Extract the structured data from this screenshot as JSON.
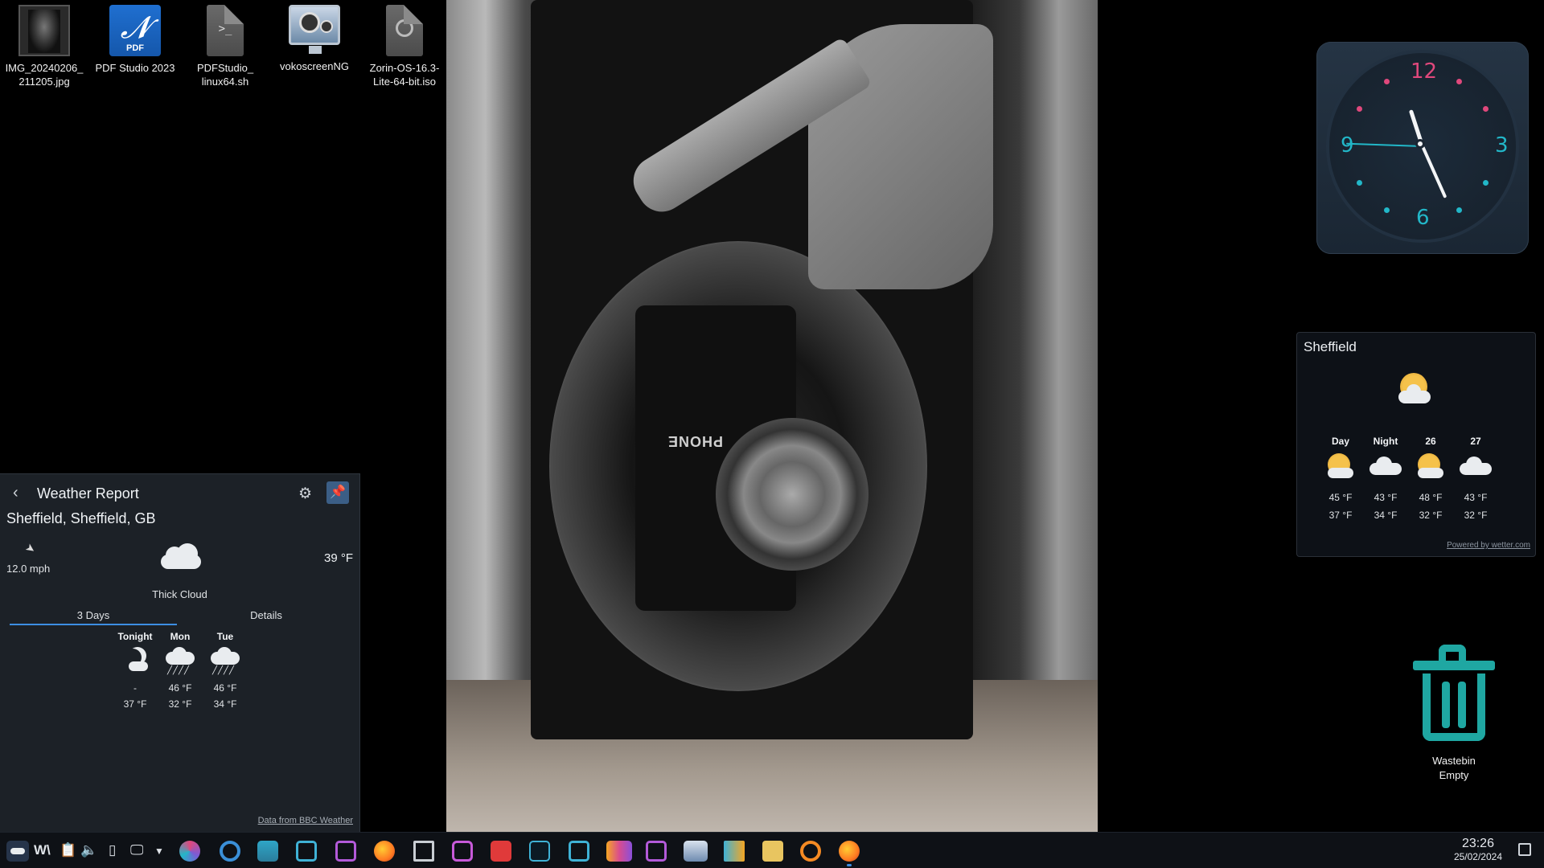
{
  "desktop": {
    "icons": [
      {
        "label": "IMG_20240206_\n211205.jpg",
        "icon": "image-file-icon"
      },
      {
        "label": "PDF Studio 2023",
        "icon": "pdf-studio-icon",
        "badge": "PDF"
      },
      {
        "label": "PDFStudio_\nlinux64.sh",
        "icon": "shell-script-icon"
      },
      {
        "label": "vokoscreenNG",
        "icon": "vokoscreen-icon"
      },
      {
        "label": "Zorin-OS-16.3-\nLite-64-bit.iso",
        "icon": "disc-image-icon"
      }
    ]
  },
  "wallpaper": {
    "label_text": "PHONE"
  },
  "weather_report": {
    "title": "Weather Report",
    "location": "Sheffield, Sheffield, GB",
    "wind_speed": "12.0 mph",
    "condition": "Thick Cloud",
    "temperature": "39 °F",
    "tabs": [
      "3 Days",
      "Details"
    ],
    "active_tab": "3 Days",
    "forecast": [
      {
        "day": "Tonight",
        "icon": "night-cloud-icon",
        "high": "-",
        "low": "37 °F"
      },
      {
        "day": "Mon",
        "icon": "rain-icon",
        "high": "46 °F",
        "low": "32 °F"
      },
      {
        "day": "Tue",
        "icon": "rain-icon",
        "high": "46 °F",
        "low": "34 °F"
      }
    ],
    "credit": "Data from BBC Weather"
  },
  "clock_widget": {
    "numbers": [
      "12",
      "3",
      "6",
      "9"
    ],
    "colors": {
      "twelve": "#e0487c",
      "three": "#22b7c8",
      "six": "#22b7c8",
      "nine": "#22b7c8"
    }
  },
  "sheffield_widget": {
    "city": "Sheffield",
    "current_icon": "partly-cloudy-icon",
    "columns": [
      {
        "label": "Day",
        "icon": "partly-cloudy-icon",
        "high": "45 °F",
        "low": "37 °F"
      },
      {
        "label": "Night",
        "icon": "cloud-icon",
        "high": "43 °F",
        "low": "34 °F"
      },
      {
        "label": "26",
        "icon": "partly-cloudy-icon",
        "high": "48 °F",
        "low": "32 °F"
      },
      {
        "label": "27",
        "icon": "cloud-icon",
        "high": "43 °F",
        "low": "32 °F"
      }
    ],
    "credit": "Powered by wetter.com"
  },
  "wastebin": {
    "label": "Wastebin\nEmpty"
  },
  "taskbar": {
    "tray_icons": [
      "weather-tray-icon",
      "wm-tray-icon",
      "clipboard-icon",
      "volume-icon",
      "usb-icon",
      "display-icon",
      "expand-tray-icon"
    ],
    "apps": [
      "color-picker-app",
      "settings-app",
      "file-manager-app",
      "screenshot-app",
      "archive-app",
      "firefox-app",
      "mail-app",
      "camera-app",
      "text-editor-app",
      "terminal-app",
      "screenshot-app-2",
      "wm-app",
      "notes-app",
      "image-viewer-app",
      "media-player-app",
      "music-app",
      "disc-burner-app",
      "firefox-app-2"
    ],
    "time": "23:26",
    "date": "25/02/2024"
  }
}
